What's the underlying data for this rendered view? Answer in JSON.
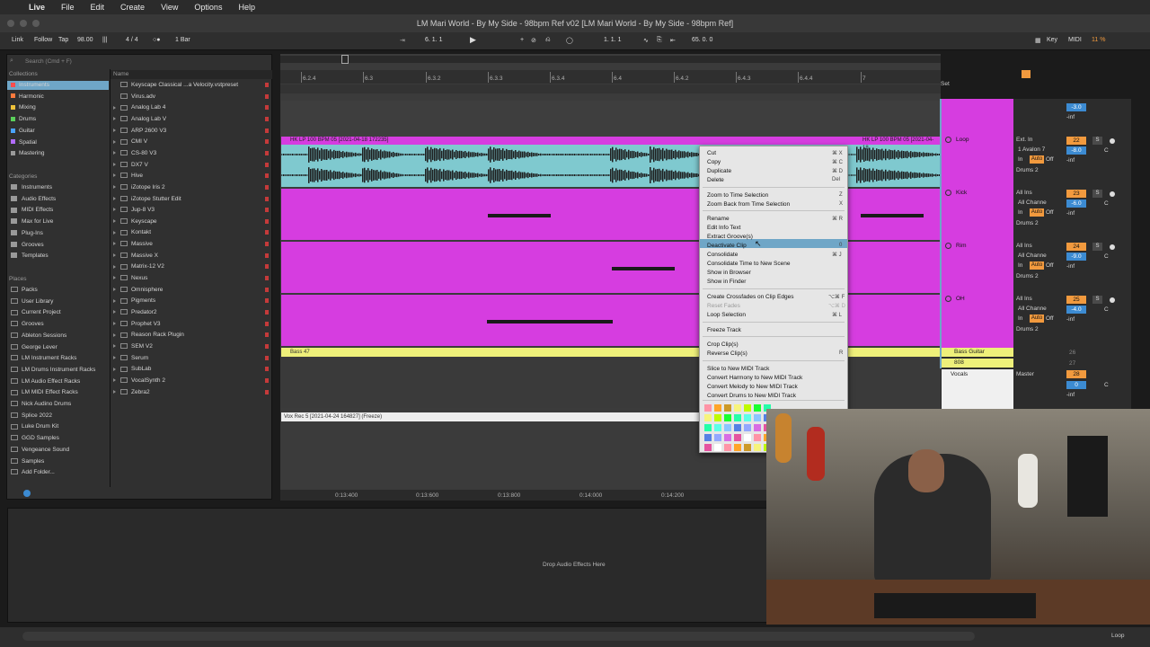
{
  "menubar": {
    "apple": "",
    "items": [
      "Live",
      "File",
      "Edit",
      "Create",
      "View",
      "Options",
      "Help"
    ]
  },
  "window_title": "LM Mari World - By My Side - 98bpm Ref v02  [LM Mari World - By My Side - 98bpm Ref]",
  "transport": {
    "link": "Link",
    "follow": "Follow",
    "tap": "Tap",
    "tempo": "98.00",
    "time_sig": "4 / 4",
    "quantize": "1 Bar",
    "position": "6.  1.  1",
    "loop_start": "1.  1.  1",
    "loop_len": "65.  0.  0",
    "key": "Key",
    "midi": "MIDI",
    "cpu": "11 %"
  },
  "browser": {
    "search_placeholder": "Search (Cmd + F)",
    "collections_header": "Collections",
    "collections": [
      {
        "label": "Instruments",
        "color": "#ff4d4d"
      },
      {
        "label": "Harmonic",
        "color": "#ff7a3d"
      },
      {
        "label": "Mixing",
        "color": "#f0c23a"
      },
      {
        "label": "Drums",
        "color": "#5ad05a"
      },
      {
        "label": "Guitar",
        "color": "#4aa3ff"
      },
      {
        "label": "Spatial",
        "color": "#b26cff"
      },
      {
        "label": "Mastering",
        "color": "#9a9a9a"
      }
    ],
    "categories_header": "Categories",
    "categories": [
      "Instruments",
      "Audio Effects",
      "MIDI Effects",
      "Max for Live",
      "Plug-Ins",
      "Grooves",
      "Templates"
    ],
    "places_header": "Places",
    "places": [
      "Packs",
      "User Library",
      "Current Project",
      "Grooves",
      "Ableton Sessions",
      "George Lever",
      "LM Instrument Racks",
      "LM Drums Instrument Racks",
      "LM Audio Effect Racks",
      "LM MIDI Effect Racks",
      "Nick Audino Drums",
      "Splice 2022",
      "Luke Drum Kit",
      "GGD Samples",
      "Vengeance Sound",
      "Samples",
      "Add Folder..."
    ],
    "name_header": "Name",
    "items": [
      "Keyscape Classical ...a Velocity.vstpreset",
      "Virus.adv",
      "Analog Lab 4",
      "Analog Lab V",
      "ARP 2600 V3",
      "CMI V",
      "CS-80 V3",
      "DX7 V",
      "Hive",
      "iZotope Iris 2",
      "iZotope Stutter Edit",
      "Jup-8 V3",
      "Keyscape",
      "Kontakt",
      "Massive",
      "Massive X",
      "Matrix-12 V2",
      "Nexus",
      "Omnisphere",
      "Pigments",
      "Predator2",
      "Prophet V3",
      "Reason Rack Plugin",
      "SEM V2",
      "Serum",
      "SubLab",
      "VocalSynth 2",
      "Zebra2"
    ]
  },
  "ruler": {
    "bars": [
      "6.2.4",
      "6.3",
      "6.3.2",
      "6.3.3",
      "6.3.4",
      "6.4",
      "6.4.2",
      "6.4.3",
      "6.4.4",
      "7"
    ],
    "time": [
      "0:13:400",
      "0:13:600",
      "0:13:800",
      "0:14:000",
      "0:14:200"
    ]
  },
  "clips": {
    "loop_a": "HK LP 100 BPM 05 [2021-04-18 172235]",
    "loop_b": "HK LP 100 BPM 05 [2021-04-18",
    "bass": "Bass 47",
    "vox": "Vox Rec 5 [2021-04-24 164827] (Freeze)"
  },
  "context_menu": {
    "items": [
      {
        "label": "Cut",
        "shortcut": "⌘ X"
      },
      {
        "label": "Copy",
        "shortcut": "⌘ C"
      },
      {
        "label": "Duplicate",
        "shortcut": "⌘ D"
      },
      {
        "label": "Delete",
        "shortcut": "Del"
      },
      {
        "label": "Zoom to Time Selection",
        "shortcut": "Z"
      },
      {
        "label": "Zoom Back from Time Selection",
        "shortcut": "X"
      },
      {
        "label": "Rename",
        "shortcut": "⌘ R"
      },
      {
        "label": "Edit Info Text",
        "shortcut": ""
      },
      {
        "label": "Extract Groove(s)",
        "shortcut": ""
      },
      {
        "label": "Deactivate Clip",
        "shortcut": "0"
      },
      {
        "label": "Consolidate",
        "shortcut": "⌘ J"
      },
      {
        "label": "Consolidate Time to New Scene",
        "shortcut": ""
      },
      {
        "label": "Show in Browser",
        "shortcut": ""
      },
      {
        "label": "Show in Finder",
        "shortcut": ""
      },
      {
        "label": "Create Crossfades on Clip Edges",
        "shortcut": "⌥⌘ F"
      },
      {
        "label": "Reset Fades",
        "shortcut": "⌥⌘ D"
      },
      {
        "label": "Loop Selection",
        "shortcut": "⌘ L"
      },
      {
        "label": "Freeze Track",
        "shortcut": ""
      },
      {
        "label": "Crop Clip(s)",
        "shortcut": ""
      },
      {
        "label": "Reverse Clip(s)",
        "shortcut": "R"
      },
      {
        "label": "Slice to New MIDI Track",
        "shortcut": ""
      },
      {
        "label": "Convert Harmony to New MIDI Track",
        "shortcut": ""
      },
      {
        "label": "Convert Melody to New MIDI Track",
        "shortcut": ""
      },
      {
        "label": "Convert Drums to New MIDI Track",
        "shortcut": ""
      }
    ],
    "highlighted": "Deactivate Clip",
    "disabled": "Reset Fades"
  },
  "mixer": {
    "set_label": "Set",
    "top_vol": "-3.0",
    "top_inf": "-inf",
    "tracks": [
      {
        "name": "Loop",
        "input": "Ext. In",
        "sub": "1 Avalon 7",
        "num": "22",
        "vol": "-8.0",
        "out": "Drums 2",
        "pan": "C"
      },
      {
        "name": "Kick",
        "input": "All Ins",
        "sub": "All Channe",
        "num": "23",
        "vol": "-6.0",
        "out": "Drums 2",
        "pan": "C"
      },
      {
        "name": "Rim",
        "input": "All Ins",
        "sub": "All Channe",
        "num": "24",
        "vol": "-9.0",
        "out": "Drums 2",
        "pan": "C"
      },
      {
        "name": "OH",
        "input": "All Ins",
        "sub": "All Channe",
        "num": "25",
        "vol": "-4.0",
        "out": "Drums 2",
        "pan": "C"
      }
    ],
    "in_label": "In",
    "auto_label": "Auto",
    "off_label": "Off",
    "inf": "-inf",
    "s": "S",
    "group_rows": [
      {
        "name": "Bass Guitar",
        "num": "26"
      },
      {
        "name": "808",
        "num": "27"
      }
    ],
    "vocals": {
      "name": "Vocals",
      "out": "Master",
      "num": "28",
      "vol": "0",
      "pan": "C",
      "inf": "-inf"
    }
  },
  "detail": {
    "drop_hint": "Drop Audio Effects Here"
  },
  "status": {
    "loop": "Loop"
  },
  "colors": {
    "accent_orange": "#f29a3e",
    "clip_magenta": "#d63de0",
    "audio_clip": "#7fc9cf",
    "bass_yellow": "#eef07a"
  }
}
